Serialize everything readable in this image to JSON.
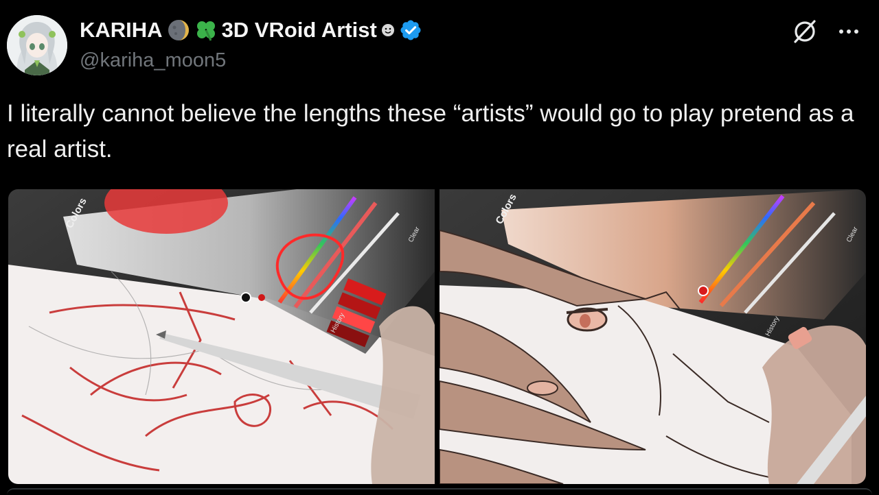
{
  "author": {
    "display_name": "KARIHA",
    "name_suffix": "3D VRoid Artist",
    "handle": "@kariha_moon5",
    "emojis": [
      "moon-emoji",
      "clover-emoji",
      "smiley-emoji"
    ],
    "verified_color": "#1d9bf0"
  },
  "tweet": {
    "text": "I literally cannot believe the lengths these “artists” would go to play pretend as a real artist."
  },
  "media": {
    "left_panel_label": "Colors",
    "right_panel_label": "Colors",
    "left_history_label": "History",
    "right_history_label": "History",
    "left_clear_label": "Clear",
    "right_clear_label": "Clear",
    "highlight_color": "#ff2a2a"
  },
  "icons": {
    "grok": "grok-icon",
    "more": "more-icon"
  }
}
